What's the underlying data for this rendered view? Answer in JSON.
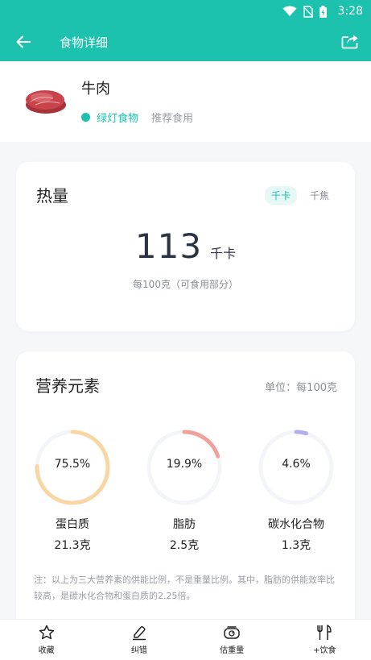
{
  "status_bar": {
    "time": "3:28"
  },
  "app_bar": {
    "title": "食物详细"
  },
  "food": {
    "name": "牛肉",
    "level_tag": "绿灯食物",
    "recommend_tag": "推荐食用",
    "level_color": "#1cc2ad"
  },
  "calories": {
    "title": "热量",
    "unit_options": [
      "千卡",
      "千焦"
    ],
    "selected_unit": "千卡",
    "value": "113",
    "unit": "千卡",
    "note": "每100克（可食用部分）"
  },
  "nutrition": {
    "title": "营养元素",
    "unit_note": "单位：每100克",
    "items": [
      {
        "name": "蛋白质",
        "percent_label": "75.5%",
        "percent": 75.5,
        "amount": "21.3克",
        "color": "#f9d7a5"
      },
      {
        "name": "脂肪",
        "percent_label": "19.9%",
        "percent": 19.9,
        "amount": "2.5克",
        "color": "#f1a19c"
      },
      {
        "name": "碳水化合物",
        "percent_label": "4.6%",
        "percent": 4.6,
        "amount": "1.3克",
        "color": "#b4b0ee"
      }
    ],
    "note": "注：以上为三大营养素的供能比例，不是重量比例。其中，脂肪的供能效率比较高，是碳水化合物和蛋白质的2.25倍。"
  },
  "bottom_nav": [
    {
      "label": "收藏",
      "icon": "star-icon"
    },
    {
      "label": "纠错",
      "icon": "edit-icon"
    },
    {
      "label": "估重量",
      "icon": "scale-icon"
    },
    {
      "label": "+饮食",
      "icon": "fork-knife-icon"
    }
  ],
  "colors": {
    "accent": "#1cc2ad"
  }
}
